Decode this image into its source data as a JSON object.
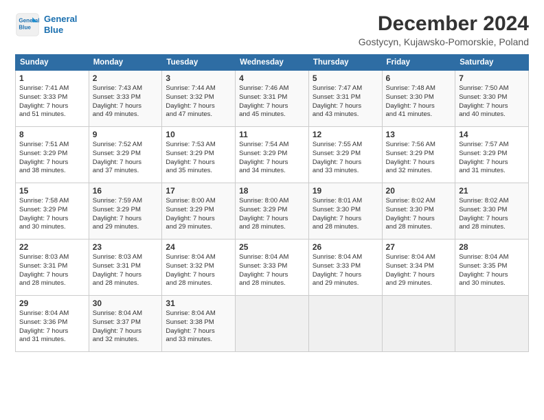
{
  "logo": {
    "line1": "General",
    "line2": "Blue"
  },
  "title": "December 2024",
  "subtitle": "Gostycyn, Kujawsko-Pomorskie, Poland",
  "days_of_week": [
    "Sunday",
    "Monday",
    "Tuesday",
    "Wednesday",
    "Thursday",
    "Friday",
    "Saturday"
  ],
  "weeks": [
    [
      {
        "day": 1,
        "lines": [
          "Sunrise: 7:41 AM",
          "Sunset: 3:33 PM",
          "Daylight: 7 hours",
          "and 51 minutes."
        ]
      },
      {
        "day": 2,
        "lines": [
          "Sunrise: 7:43 AM",
          "Sunset: 3:33 PM",
          "Daylight: 7 hours",
          "and 49 minutes."
        ]
      },
      {
        "day": 3,
        "lines": [
          "Sunrise: 7:44 AM",
          "Sunset: 3:32 PM",
          "Daylight: 7 hours",
          "and 47 minutes."
        ]
      },
      {
        "day": 4,
        "lines": [
          "Sunrise: 7:46 AM",
          "Sunset: 3:31 PM",
          "Daylight: 7 hours",
          "and 45 minutes."
        ]
      },
      {
        "day": 5,
        "lines": [
          "Sunrise: 7:47 AM",
          "Sunset: 3:31 PM",
          "Daylight: 7 hours",
          "and 43 minutes."
        ]
      },
      {
        "day": 6,
        "lines": [
          "Sunrise: 7:48 AM",
          "Sunset: 3:30 PM",
          "Daylight: 7 hours",
          "and 41 minutes."
        ]
      },
      {
        "day": 7,
        "lines": [
          "Sunrise: 7:50 AM",
          "Sunset: 3:30 PM",
          "Daylight: 7 hours",
          "and 40 minutes."
        ]
      }
    ],
    [
      {
        "day": 8,
        "lines": [
          "Sunrise: 7:51 AM",
          "Sunset: 3:29 PM",
          "Daylight: 7 hours",
          "and 38 minutes."
        ]
      },
      {
        "day": 9,
        "lines": [
          "Sunrise: 7:52 AM",
          "Sunset: 3:29 PM",
          "Daylight: 7 hours",
          "and 37 minutes."
        ]
      },
      {
        "day": 10,
        "lines": [
          "Sunrise: 7:53 AM",
          "Sunset: 3:29 PM",
          "Daylight: 7 hours",
          "and 35 minutes."
        ]
      },
      {
        "day": 11,
        "lines": [
          "Sunrise: 7:54 AM",
          "Sunset: 3:29 PM",
          "Daylight: 7 hours",
          "and 34 minutes."
        ]
      },
      {
        "day": 12,
        "lines": [
          "Sunrise: 7:55 AM",
          "Sunset: 3:29 PM",
          "Daylight: 7 hours",
          "and 33 minutes."
        ]
      },
      {
        "day": 13,
        "lines": [
          "Sunrise: 7:56 AM",
          "Sunset: 3:29 PM",
          "Daylight: 7 hours",
          "and 32 minutes."
        ]
      },
      {
        "day": 14,
        "lines": [
          "Sunrise: 7:57 AM",
          "Sunset: 3:29 PM",
          "Daylight: 7 hours",
          "and 31 minutes."
        ]
      }
    ],
    [
      {
        "day": 15,
        "lines": [
          "Sunrise: 7:58 AM",
          "Sunset: 3:29 PM",
          "Daylight: 7 hours",
          "and 30 minutes."
        ]
      },
      {
        "day": 16,
        "lines": [
          "Sunrise: 7:59 AM",
          "Sunset: 3:29 PM",
          "Daylight: 7 hours",
          "and 29 minutes."
        ]
      },
      {
        "day": 17,
        "lines": [
          "Sunrise: 8:00 AM",
          "Sunset: 3:29 PM",
          "Daylight: 7 hours",
          "and 29 minutes."
        ]
      },
      {
        "day": 18,
        "lines": [
          "Sunrise: 8:00 AM",
          "Sunset: 3:29 PM",
          "Daylight: 7 hours",
          "and 28 minutes."
        ]
      },
      {
        "day": 19,
        "lines": [
          "Sunrise: 8:01 AM",
          "Sunset: 3:30 PM",
          "Daylight: 7 hours",
          "and 28 minutes."
        ]
      },
      {
        "day": 20,
        "lines": [
          "Sunrise: 8:02 AM",
          "Sunset: 3:30 PM",
          "Daylight: 7 hours",
          "and 28 minutes."
        ]
      },
      {
        "day": 21,
        "lines": [
          "Sunrise: 8:02 AM",
          "Sunset: 3:30 PM",
          "Daylight: 7 hours",
          "and 28 minutes."
        ]
      }
    ],
    [
      {
        "day": 22,
        "lines": [
          "Sunrise: 8:03 AM",
          "Sunset: 3:31 PM",
          "Daylight: 7 hours",
          "and 28 minutes."
        ]
      },
      {
        "day": 23,
        "lines": [
          "Sunrise: 8:03 AM",
          "Sunset: 3:31 PM",
          "Daylight: 7 hours",
          "and 28 minutes."
        ]
      },
      {
        "day": 24,
        "lines": [
          "Sunrise: 8:04 AM",
          "Sunset: 3:32 PM",
          "Daylight: 7 hours",
          "and 28 minutes."
        ]
      },
      {
        "day": 25,
        "lines": [
          "Sunrise: 8:04 AM",
          "Sunset: 3:33 PM",
          "Daylight: 7 hours",
          "and 28 minutes."
        ]
      },
      {
        "day": 26,
        "lines": [
          "Sunrise: 8:04 AM",
          "Sunset: 3:33 PM",
          "Daylight: 7 hours",
          "and 29 minutes."
        ]
      },
      {
        "day": 27,
        "lines": [
          "Sunrise: 8:04 AM",
          "Sunset: 3:34 PM",
          "Daylight: 7 hours",
          "and 29 minutes."
        ]
      },
      {
        "day": 28,
        "lines": [
          "Sunrise: 8:04 AM",
          "Sunset: 3:35 PM",
          "Daylight: 7 hours",
          "and 30 minutes."
        ]
      }
    ],
    [
      {
        "day": 29,
        "lines": [
          "Sunrise: 8:04 AM",
          "Sunset: 3:36 PM",
          "Daylight: 7 hours",
          "and 31 minutes."
        ]
      },
      {
        "day": 30,
        "lines": [
          "Sunrise: 8:04 AM",
          "Sunset: 3:37 PM",
          "Daylight: 7 hours",
          "and 32 minutes."
        ]
      },
      {
        "day": 31,
        "lines": [
          "Sunrise: 8:04 AM",
          "Sunset: 3:38 PM",
          "Daylight: 7 hours",
          "and 33 minutes."
        ]
      },
      null,
      null,
      null,
      null
    ]
  ]
}
